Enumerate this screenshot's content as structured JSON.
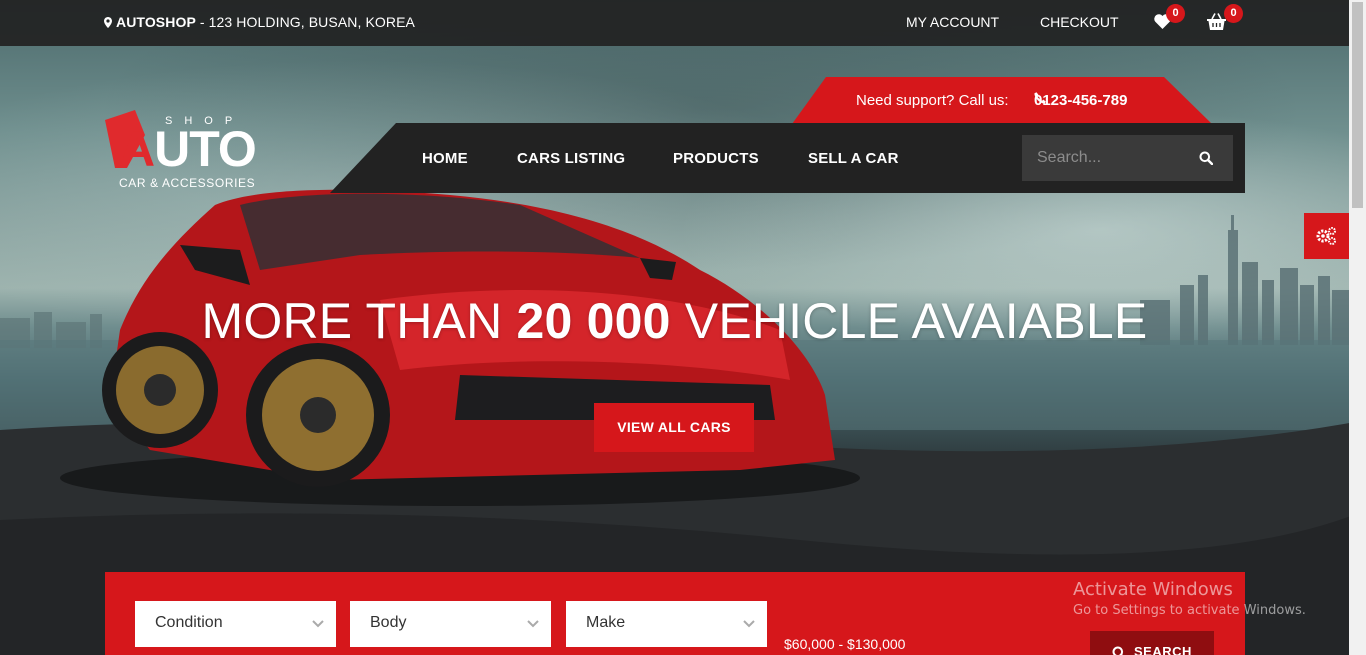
{
  "topbar": {
    "brand": "AUTOSHOP",
    "address": " - 123 HOLDING, BUSAN, KOREA",
    "my_account": "MY ACCOUNT",
    "checkout": "CHECKOUT",
    "wishlist_count": "0",
    "cart_count": "0"
  },
  "logo": {
    "shop": "SHOP",
    "auto_first": "A",
    "auto_rest": "UTO",
    "tagline": "CAR & ACCESSORIES"
  },
  "support": {
    "text": "Need support? Call us:",
    "phone": "0123-456-789"
  },
  "nav": {
    "items": [
      {
        "label": "HOME"
      },
      {
        "label": "CARS LISTING"
      },
      {
        "label": "PRODUCTS"
      },
      {
        "label": "SELL A CAR"
      }
    ],
    "search_placeholder": "Search..."
  },
  "hero": {
    "headline_pre": "MORE THAN ",
    "headline_bold": "20 000",
    "headline_post": " VEHICLE AVAIABLE",
    "cta": "VIEW ALL CARS"
  },
  "filter": {
    "condition": "Condition",
    "body": "Body",
    "make": "Make",
    "price_range": "$60,000 - $130,000",
    "search": "SEARCH"
  },
  "watermark": {
    "title": "Activate Windows",
    "subtitle": "Go to Settings to activate Windows."
  },
  "colors": {
    "accent": "#d6171b",
    "dark": "#222222"
  }
}
